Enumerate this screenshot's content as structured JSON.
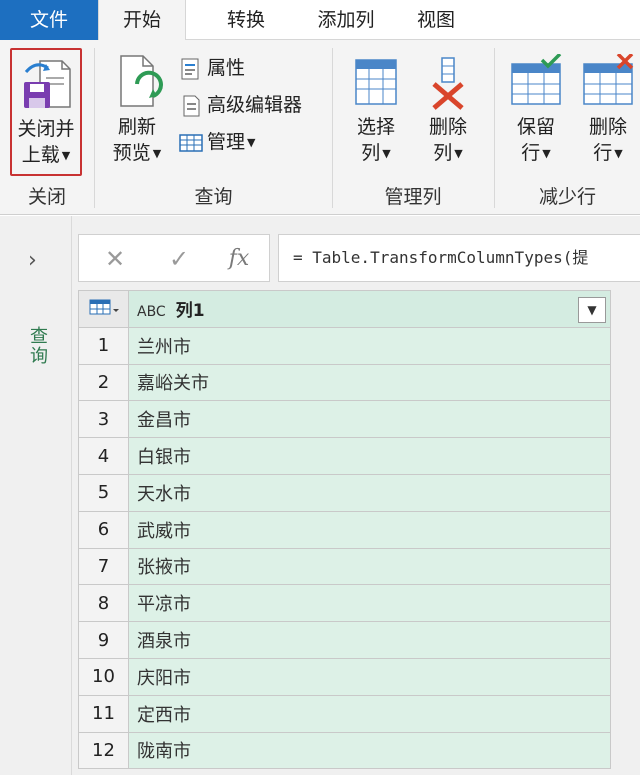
{
  "tabs": {
    "file": "文件",
    "home": "开始",
    "transform": "转换",
    "add_column": "添加列",
    "view": "视图"
  },
  "ribbon": {
    "close_group": {
      "button_line1": "关闭并",
      "button_line2": "上载",
      "label": "关闭"
    },
    "query_group": {
      "refresh_line1": "刷新",
      "refresh_line2": "预览",
      "properties": "属性",
      "advanced_editor": "高级编辑器",
      "manage": "管理",
      "label": "查询"
    },
    "manage_columns_group": {
      "choose_line1": "选择",
      "choose_line2": "列",
      "remove_line1": "删除",
      "remove_line2": "列",
      "label": "管理列"
    },
    "reduce_rows_group": {
      "keep_line1": "保留",
      "keep_line2": "行",
      "remove_line1": "删除",
      "remove_line2": "行",
      "label": "减少行"
    }
  },
  "left_pane": {
    "label": "查询",
    "expand_glyph": "›"
  },
  "formula_bar": {
    "cancel_glyph": "✕",
    "confirm_glyph": "✓",
    "fx_label": "fx",
    "formula": "= Table.TransformColumnTypes(提"
  },
  "grid": {
    "column_type": "ABC",
    "column_header": "列1",
    "rows": [
      {
        "num": "1",
        "value": "兰州市"
      },
      {
        "num": "2",
        "value": "嘉峪关市"
      },
      {
        "num": "3",
        "value": "金昌市"
      },
      {
        "num": "4",
        "value": "白银市"
      },
      {
        "num": "5",
        "value": "天水市"
      },
      {
        "num": "6",
        "value": "武威市"
      },
      {
        "num": "7",
        "value": "张掖市"
      },
      {
        "num": "8",
        "value": "平凉市"
      },
      {
        "num": "9",
        "value": "酒泉市"
      },
      {
        "num": "10",
        "value": "庆阳市"
      },
      {
        "num": "11",
        "value": "定西市"
      },
      {
        "num": "12",
        "value": "陇南市"
      }
    ]
  },
  "colors": {
    "file_tab": "#1d6fc0",
    "selection_border": "#c83232",
    "column_fill": "#ddf1e7",
    "pane_label": "#2f7a4f"
  }
}
